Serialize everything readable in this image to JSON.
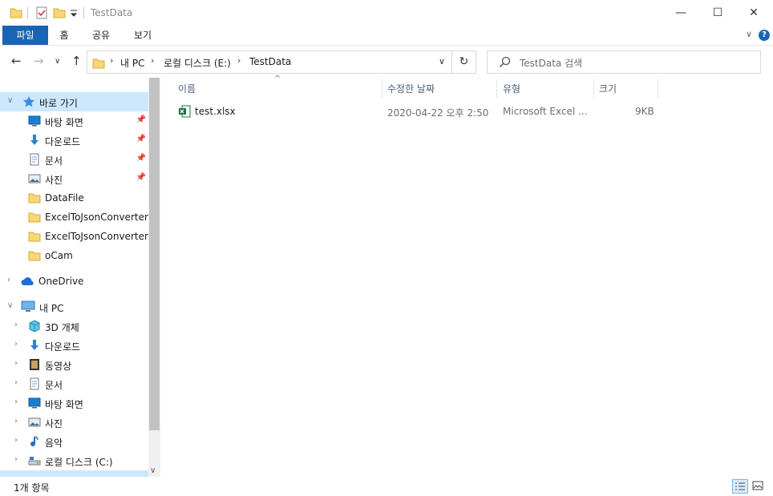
{
  "window": {
    "title": "TestData",
    "minimize_glyph": "—",
    "maximize_glyph": "☐",
    "close_glyph": "✕"
  },
  "ribbon": {
    "tabs": [
      "파일",
      "홈",
      "공유",
      "보기"
    ],
    "help_glyph": "?",
    "collapse_glyph": "∨"
  },
  "nav": {
    "back_glyph": "←",
    "forward_glyph": "→",
    "recent_glyph": "∨",
    "up_glyph": "↑",
    "refresh_glyph": "↻",
    "breadcrumb": [
      "내 PC",
      "로컬 디스크 (E:)",
      "TestData"
    ],
    "crumb_sep": "›",
    "dropdown_glyph": "∨"
  },
  "search": {
    "placeholder": "TestData 검색"
  },
  "sidebar": {
    "quick_access": "바로 가기",
    "pinned": [
      {
        "label": "바탕 화면",
        "icon": "desktop-icon"
      },
      {
        "label": "다운로드",
        "icon": "download-icon"
      },
      {
        "label": "문서",
        "icon": "document-icon"
      },
      {
        "label": "사진",
        "icon": "picture-icon"
      }
    ],
    "recent_folders": [
      "DataFile",
      "ExcelToJsonConverter",
      "ExcelToJsonConverterDe",
      "oCam"
    ],
    "onedrive": "OneDrive",
    "this_pc": "내 PC",
    "pc_items": [
      {
        "label": "3D 개체",
        "icon": "3d-objects-icon"
      },
      {
        "label": "다운로드",
        "icon": "download-icon"
      },
      {
        "label": "동영상",
        "icon": "video-icon"
      },
      {
        "label": "문서",
        "icon": "document-icon"
      },
      {
        "label": "바탕 화면",
        "icon": "desktop-icon"
      },
      {
        "label": "사진",
        "icon": "picture-icon"
      },
      {
        "label": "음악",
        "icon": "music-icon"
      },
      {
        "label": "로컬 디스크 (C:)",
        "icon": "drive-icon"
      }
    ],
    "expand_glyph": "›",
    "collapse_glyph": "∨",
    "pin_glyph": "📌"
  },
  "columns": {
    "name": "이름",
    "modified": "수정한 날짜",
    "type": "유형",
    "size": "크기",
    "sort_glyph": "^"
  },
  "files": [
    {
      "name": "test.xlsx",
      "modified": "2020-04-22 오후 2:50",
      "type": "Microsoft Excel ...",
      "size": "9KB"
    }
  ],
  "status": {
    "item_count": "1개 항목"
  },
  "colors": {
    "accent": "#1a64b4",
    "selected_bg": "#cce8ff",
    "folder": "#f8d775",
    "excel_green": "#1d6f42"
  }
}
